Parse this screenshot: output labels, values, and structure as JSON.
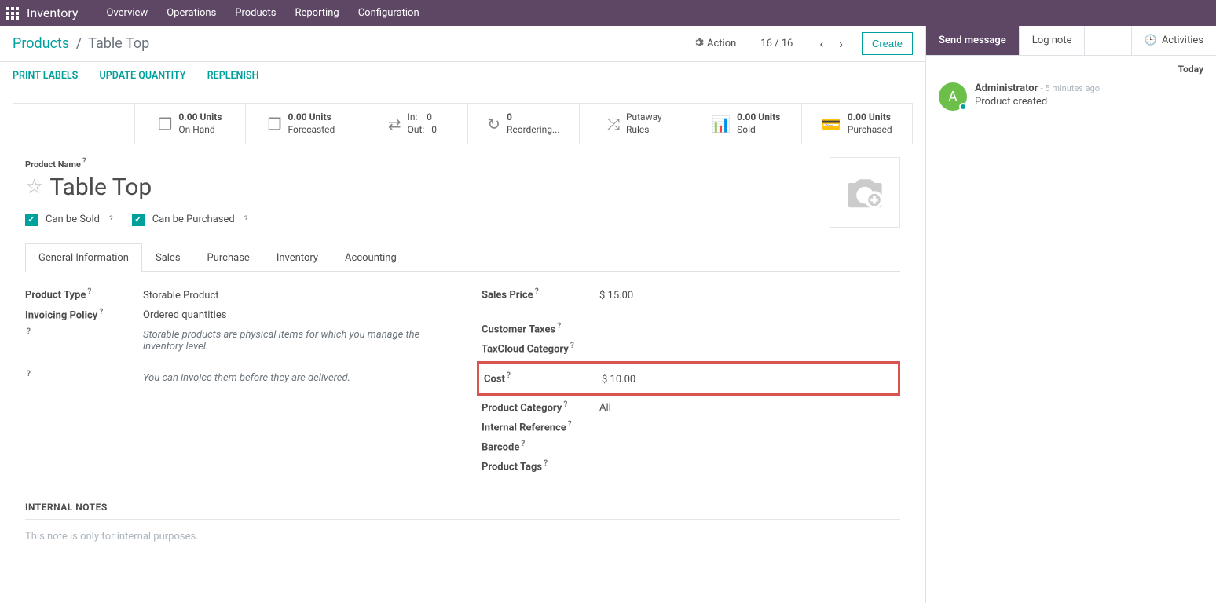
{
  "nav": {
    "brand": "Inventory",
    "items": [
      "Overview",
      "Operations",
      "Products",
      "Reporting",
      "Configuration"
    ]
  },
  "breadcrumb": {
    "link": "Products",
    "sep": "/",
    "current": "Table Top"
  },
  "controls": {
    "action": "Action",
    "pager": "16 / 16",
    "create": "Create"
  },
  "toolbar": [
    "PRINT LABELS",
    "UPDATE QUANTITY",
    "REPLENISH"
  ],
  "stats": [
    {
      "v": "0.00 Units",
      "l": "On Hand"
    },
    {
      "v": "0.00 Units",
      "l": "Forecasted"
    },
    {
      "v": "In:    0",
      "l": "Out:   0"
    },
    {
      "v": "0",
      "l": "Reordering..."
    },
    {
      "v": "Putaway",
      "l": "Rules"
    },
    {
      "v": "0.00 Units",
      "l": "Sold"
    },
    {
      "v": "0.00 Units",
      "l": "Purchased"
    }
  ],
  "product": {
    "nameLabel": "Product Name",
    "name": "Table Top",
    "canSold": "Can be Sold",
    "canPurchased": "Can be Purchased"
  },
  "tabs": [
    "General Information",
    "Sales",
    "Purchase",
    "Inventory",
    "Accounting"
  ],
  "left": {
    "productTypeL": "Product Type",
    "productType": "Storable Product",
    "invoicePolicyL": "Invoicing Policy",
    "invoicePolicy": "Ordered quantities",
    "note1": "Storable products are physical items for which you manage the inventory level.",
    "note2": "You can invoice them before they are delivered."
  },
  "right": {
    "salesPriceL": "Sales Price",
    "salesPrice": "$ 15.00",
    "custTaxL": "Customer Taxes",
    "taxCloudL": "TaxCloud Category",
    "costL": "Cost",
    "cost": "$ 10.00",
    "catL": "Product Category",
    "cat": "All",
    "refL": "Internal Reference",
    "barcodeL": "Barcode",
    "tagsL": "Product Tags"
  },
  "notes": {
    "header": "INTERNAL NOTES",
    "placeholder": "This note is only for internal purposes."
  },
  "side": {
    "send": "Send message",
    "log": "Log note",
    "act": "Activities",
    "today": "Today",
    "author": "Administrator",
    "time": "- 5 minutes ago",
    "text": "Product created"
  }
}
